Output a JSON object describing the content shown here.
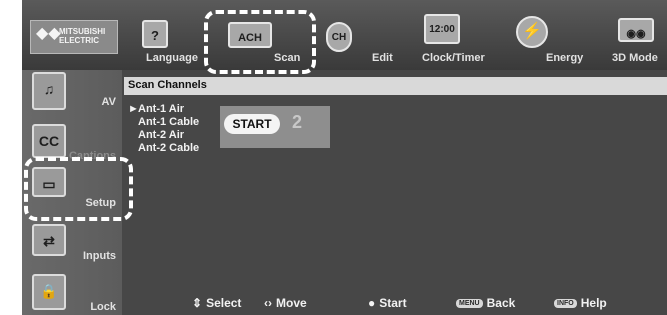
{
  "brand": {
    "name": "MITSUBISHI ELECTRIC"
  },
  "tabs": [
    {
      "label": "Language",
      "icon": "language-icon"
    },
    {
      "label": "Scan",
      "icon": "scan-channel-icon",
      "icon_text": "ACH"
    },
    {
      "label": "",
      "icon": "ch-icon",
      "icon_text": "CH"
    },
    {
      "label": "Edit",
      "icon": "edit-icon"
    },
    {
      "label": "Clock/Timer",
      "icon": "clock-icon",
      "icon_text": "12:00"
    },
    {
      "label": "Energy",
      "icon": "energy-icon"
    },
    {
      "label": "3D Mode",
      "icon": "3d-glasses-icon"
    }
  ],
  "sidebar": [
    {
      "label": "AV",
      "icon": "speaker-icon"
    },
    {
      "label": "Captions",
      "icon": "cc-icon",
      "icon_text": "CC"
    },
    {
      "label": "Setup",
      "icon": "setup-tv-icon"
    },
    {
      "label": "Inputs",
      "icon": "inputs-icon"
    },
    {
      "label": "Lock",
      "icon": "lock-icon"
    }
  ],
  "content": {
    "title": "Scan Channels",
    "channels": [
      {
        "label": "Ant-1 Air",
        "marker": "►"
      },
      {
        "label": "Ant-1 Cable",
        "marker": ""
      },
      {
        "label": "Ant-2 Air",
        "marker": ""
      },
      {
        "label": "Ant-2 Cable",
        "marker": ""
      }
    ],
    "start_label": "START",
    "start_number": "2"
  },
  "footer": {
    "select": "Select",
    "move": "Move",
    "start": "Start",
    "back": "Back",
    "back_key": "MENU",
    "help": "Help",
    "help_key": "INFO"
  },
  "colors": {
    "background": "#474747",
    "highlight": "#ffffff",
    "header": "#d9d9d9",
    "start_panel": "#8e8e8e"
  }
}
